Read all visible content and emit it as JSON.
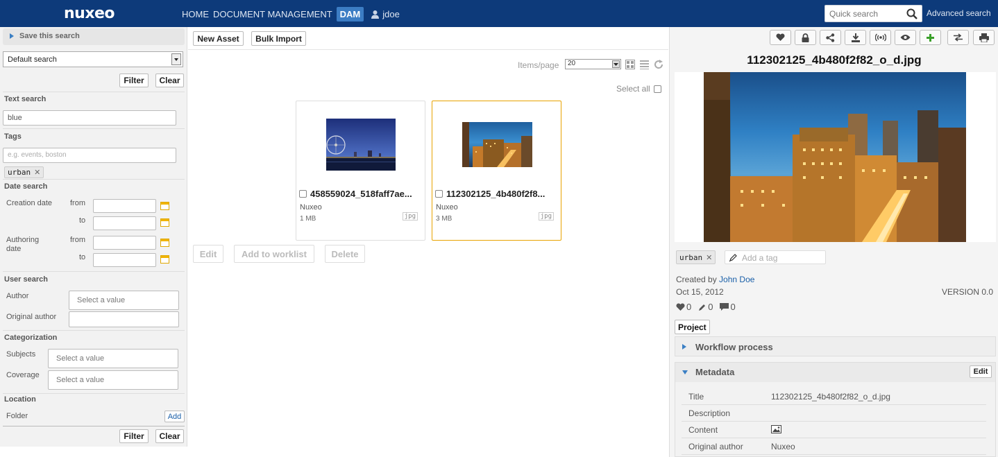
{
  "topbar": {
    "logo": "nuxeo",
    "nav": [
      "HOME",
      "DOCUMENT MANAGEMENT",
      "DAM"
    ],
    "active_nav": "DAM",
    "user": "jdoe",
    "quick_search_placeholder": "Quick search",
    "advanced_search": "Advanced search",
    "bg_color": "#0d3a7a"
  },
  "left": {
    "save_search": "Save this search",
    "search_select": "Default search",
    "filter": "Filter",
    "clear": "Clear",
    "text_search": {
      "label": "Text search",
      "value": "blue"
    },
    "tags": {
      "label": "Tags",
      "placeholder": "e.g. events, boston",
      "selected": "urban"
    },
    "date_search": {
      "label": "Date search",
      "creation_date": "Creation date",
      "authoring_date": "Authoring date",
      "from": "from",
      "to": "to"
    },
    "user_search": {
      "label": "User search",
      "author": "Author",
      "original_author": "Original author",
      "placeholder": "Select a value"
    },
    "categorization": {
      "label": "Categorization",
      "subjects": "Subjects",
      "coverage": "Coverage",
      "placeholder": "Select a value"
    },
    "location": {
      "label": "Location",
      "folder": "Folder",
      "add": "Add"
    }
  },
  "center": {
    "new_asset": "New Asset",
    "bulk_import": "Bulk Import",
    "items_page_label": "Items/page",
    "items_page_value": "20",
    "select_all": "Select all",
    "assets": [
      {
        "title": "458559024_518faff7ae...",
        "author": "Nuxeo",
        "size": "1 MB",
        "ext": "jpg",
        "selected": false
      },
      {
        "title": "112302125_4b480f2f8...",
        "author": "Nuxeo",
        "size": "3 MB",
        "ext": "jpg",
        "selected": true
      }
    ],
    "actions": {
      "edit": "Edit",
      "add_to_worklist": "Add to worklist",
      "delete": "Delete"
    }
  },
  "right": {
    "toolbar_icons": [
      "heart-icon",
      "lock-icon",
      "share-icon",
      "download-icon",
      "broadcast-icon",
      "eye-icon",
      "plus-icon",
      "swap-icon",
      "print-icon"
    ],
    "title": "112302125_4b480f2f82_o_d.jpg",
    "tag": "urban",
    "add_tag_placeholder": "Add a tag",
    "created_by_label": "Created by",
    "created_by": "John Doe",
    "date": "Oct 15, 2012",
    "version": "VERSION 0.0",
    "likes": "0",
    "edits": "0",
    "comments": "0",
    "project": "Project",
    "workflow": "Workflow process",
    "metadata": "Metadata",
    "metadata_edit": "Edit",
    "metadata_rows": [
      {
        "key": "Title",
        "value": "112302125_4b480f2f82_o_d.jpg"
      },
      {
        "key": "Description",
        "value": ""
      },
      {
        "key": "Content",
        "value": ""
      },
      {
        "key": "Original author",
        "value": "Nuxeo"
      }
    ]
  }
}
